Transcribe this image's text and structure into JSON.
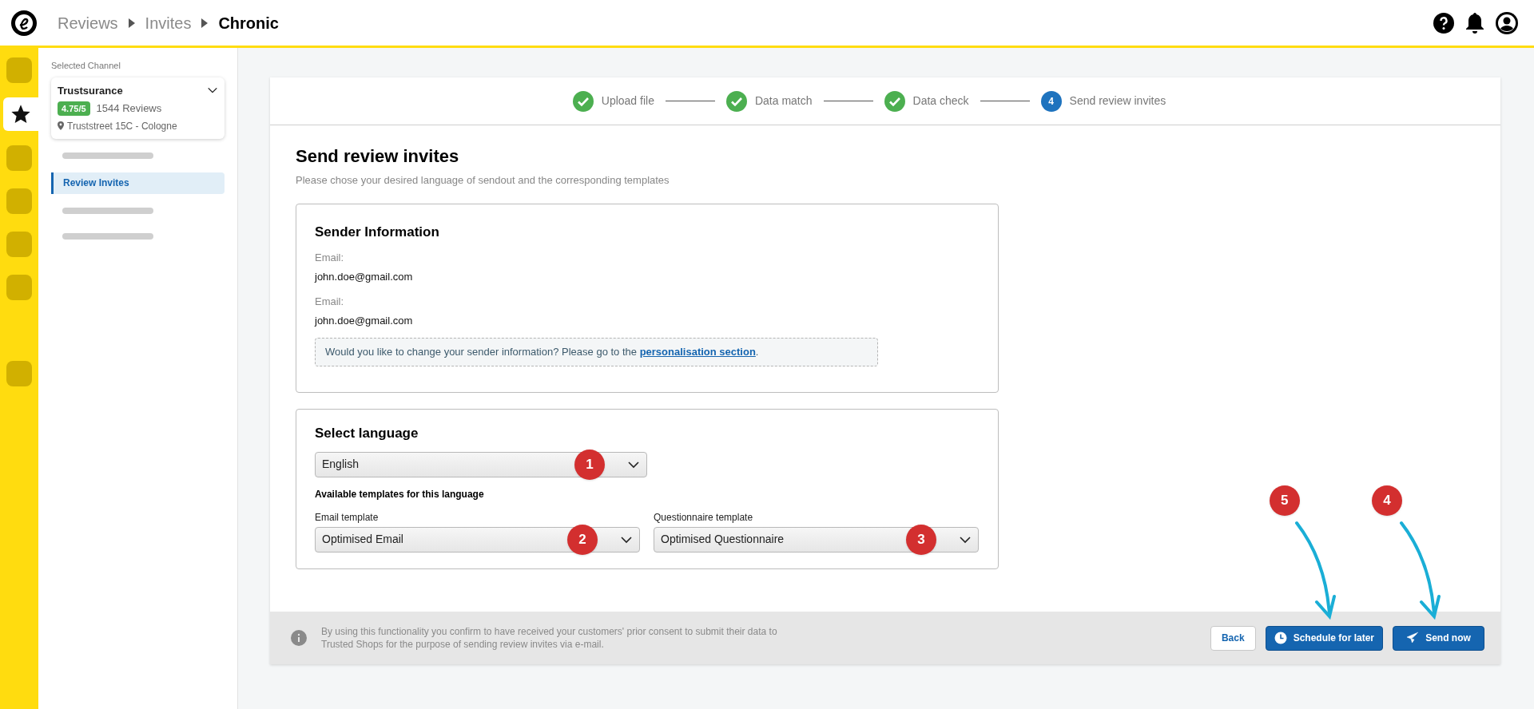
{
  "breadcrumbs": [
    {
      "label": "Reviews",
      "current": false
    },
    {
      "label": "Invites",
      "current": false
    },
    {
      "label": "Chronic",
      "current": true
    }
  ],
  "rail": [
    {
      "kind": "placeholder",
      "selected": false
    },
    {
      "kind": "star",
      "selected": true
    },
    {
      "kind": "placeholder",
      "selected": false
    },
    {
      "kind": "placeholder",
      "selected": false
    },
    {
      "kind": "placeholder",
      "selected": false
    },
    {
      "kind": "placeholder",
      "selected": false
    }
  ],
  "rail_bottom": [
    {
      "kind": "placeholder",
      "selected": false
    }
  ],
  "sidebar": {
    "heading": "Selected Channel",
    "channel": {
      "name": "Trustsurance",
      "rating": "4.75/5",
      "reviews": "1544 Reviews",
      "address": "Truststreet 15C - Cologne"
    },
    "items": [
      {
        "kind": "placeholder",
        "selected": false
      },
      {
        "kind": "link",
        "label": "Review Invites",
        "selected": true
      },
      {
        "kind": "placeholder",
        "selected": false
      },
      {
        "kind": "placeholder",
        "selected": false
      }
    ]
  },
  "steps": [
    {
      "label": "Upload file",
      "done": true
    },
    {
      "label": "Data match",
      "done": true
    },
    {
      "label": "Data check",
      "done": true
    },
    {
      "label": "Send review invites",
      "done": false,
      "number": "4"
    }
  ],
  "title": "Send review invites",
  "subtitle": "Please chose your desired language of sendout and the corresponding templates",
  "sender": {
    "title": "Sender Information",
    "fields": [
      {
        "label": "Email:",
        "value": "john.doe@gmail.com"
      },
      {
        "label": "Email:",
        "value": "john.doe@gmail.com"
      }
    ],
    "note": "Would you like to change your sender information? Please go to the ",
    "link": "personalisation section",
    "note_end": "."
  },
  "language": {
    "title": "Select language",
    "select": {
      "value": "English",
      "annotation": "1"
    },
    "templates_heading": "Available templates for this language",
    "templates": [
      {
        "label": "Email template",
        "value": "Optimised Email",
        "annotation": "2"
      },
      {
        "label": "Questionnaire template",
        "value": "Optimised Questionnaire",
        "annotation": "3"
      }
    ]
  },
  "footer": {
    "consent": "By using this functionality you confirm to have received your customers' prior consent to submit their data to Trusted Shops for the purpose of sending review invites via e-mail.",
    "buttons": [
      {
        "label": "Back",
        "kind": "secondary"
      },
      {
        "label": "Schedule for later",
        "kind": "schedule",
        "annotation": "5"
      },
      {
        "label": "Send now",
        "kind": "send",
        "annotation": "4"
      }
    ]
  }
}
